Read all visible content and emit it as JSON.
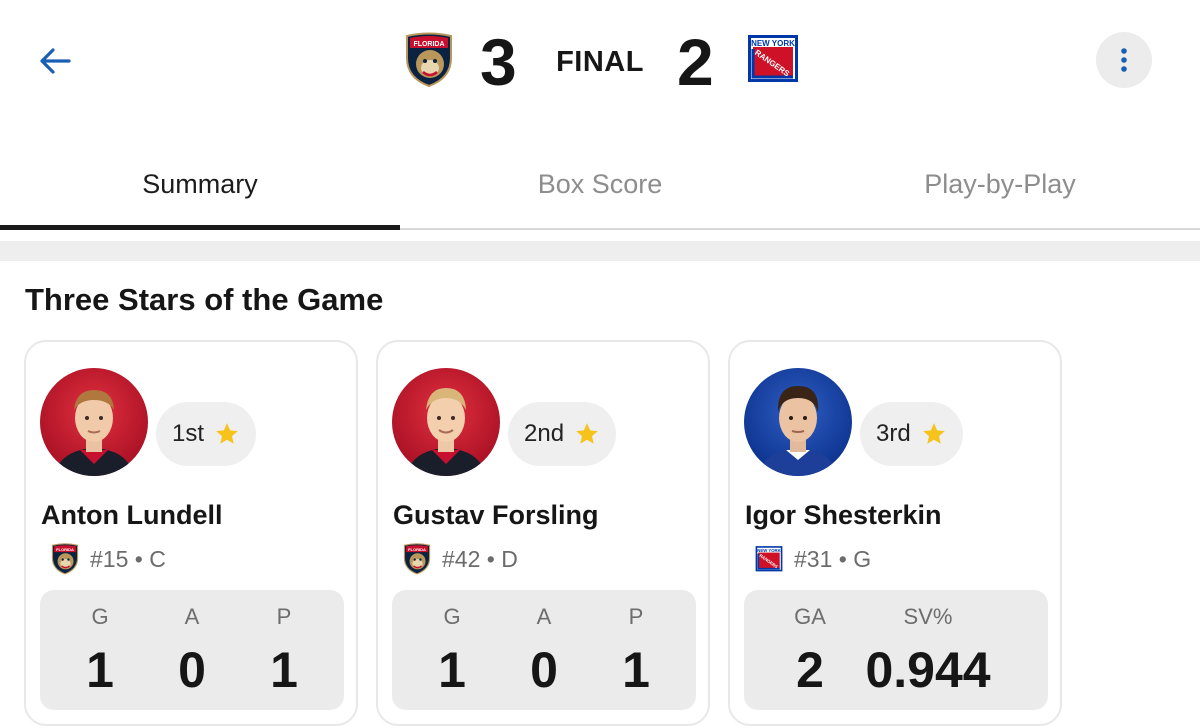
{
  "header": {
    "home_score": "3",
    "away_score": "2",
    "status": "FINAL",
    "home_team_icon": "panthers-logo-icon",
    "away_team_icon": "rangers-logo-icon",
    "accent_color": "#1b5fb4"
  },
  "tabs": [
    {
      "label": "Summary",
      "active": true
    },
    {
      "label": "Box Score",
      "active": false
    },
    {
      "label": "Play-by-Play",
      "active": false
    }
  ],
  "section": {
    "title": "Three Stars of the Game"
  },
  "stars": [
    {
      "rank": "1st",
      "name": "Anton Lundell",
      "team_icon": "panthers-logo-icon",
      "number_position": "#15 • C",
      "stats": [
        {
          "label": "G",
          "value": "1"
        },
        {
          "label": "A",
          "value": "0"
        },
        {
          "label": "P",
          "value": "1"
        }
      ]
    },
    {
      "rank": "2nd",
      "name": "Gustav Forsling",
      "team_icon": "panthers-logo-icon",
      "number_position": "#42 • D",
      "stats": [
        {
          "label": "G",
          "value": "1"
        },
        {
          "label": "A",
          "value": "0"
        },
        {
          "label": "P",
          "value": "1"
        }
      ]
    },
    {
      "rank": "3rd",
      "name": "Igor Shesterkin",
      "team_icon": "rangers-logo-icon",
      "number_position": "#31 • G",
      "stats": [
        {
          "label": "GA",
          "value": "2"
        },
        {
          "label": "SV%",
          "value": "0.944"
        }
      ]
    }
  ],
  "colors": {
    "star": "#f6c21c",
    "panthers_red": "#c8102e",
    "rangers_blue": "#0038a8"
  }
}
